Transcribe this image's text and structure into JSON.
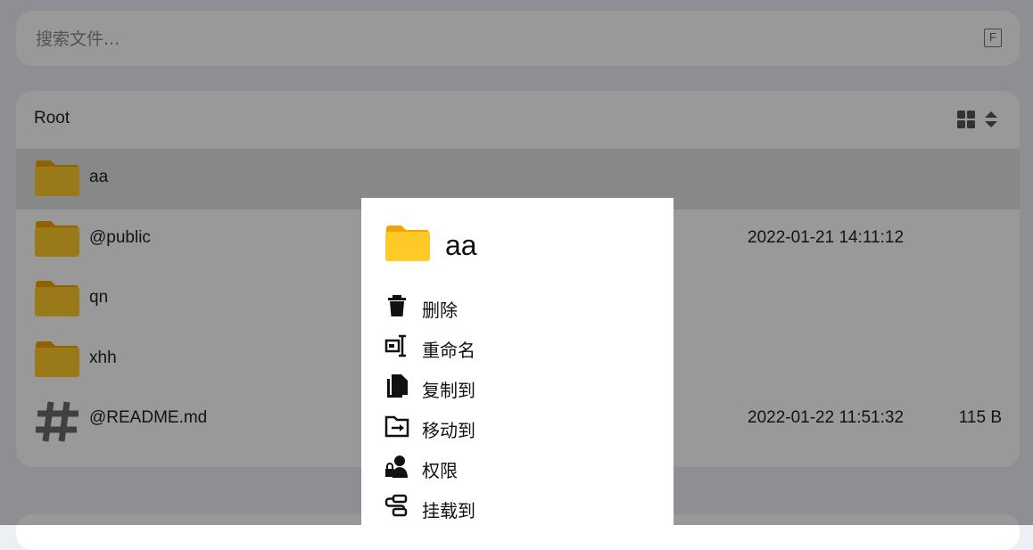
{
  "search": {
    "placeholder": "搜索文件...",
    "shortcut": "F"
  },
  "breadcrumb": {
    "root": "Root"
  },
  "files": [
    {
      "name": "aa",
      "type": "folder",
      "date": "",
      "size": "",
      "selected": true
    },
    {
      "name": "@public",
      "type": "folder",
      "date": "2022-01-21 14:11:12",
      "size": ""
    },
    {
      "name": "qn",
      "type": "folder",
      "date": "",
      "size": ""
    },
    {
      "name": "xhh",
      "type": "folder",
      "date": "",
      "size": ""
    },
    {
      "name": "@README.md",
      "type": "markdown",
      "date": "2022-01-22 11:51:32",
      "size": "115 B"
    }
  ],
  "context_menu": {
    "title": "aa",
    "items": [
      {
        "label": "删除",
        "icon": "trash-icon"
      },
      {
        "label": "重命名",
        "icon": "rename-icon"
      },
      {
        "label": "复制到",
        "icon": "copy-icon"
      },
      {
        "label": "移动到",
        "icon": "move-icon"
      },
      {
        "label": "权限",
        "icon": "permission-icon"
      },
      {
        "label": "挂载到",
        "icon": "mount-icon"
      }
    ]
  },
  "colors": {
    "folder": "#ffca28",
    "folder_tab": "#f0a500",
    "background": "#eceff3"
  }
}
